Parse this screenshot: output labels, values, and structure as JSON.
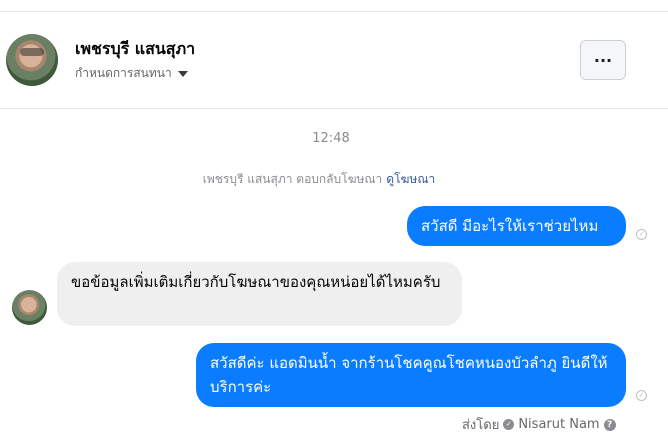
{
  "header": {
    "name": "เพชรบุรี แสนสุภา",
    "subtitle": "กำหนดการสนทนา",
    "more_label": "···"
  },
  "conversation": {
    "timestamp": "12:48",
    "ad_reply_text": "เพชรบุรี แสนสุภา ตอบกลับโฆษณา",
    "ad_link": "ดูโฆษณา",
    "messages": [
      {
        "direction": "outgoing",
        "text": "สวัสดี มีอะไรให้เราช่วยไหม"
      },
      {
        "direction": "incoming",
        "text": "ขอข้อมูลเพิ่มเติมเกี่ยวกับโฆษณาของคุณหน่อยได้ไหมครับ"
      },
      {
        "direction": "outgoing",
        "text": "สวัสดีค่ะ แอดมินน้ำ จากร้านโชคคูณโชคหนองบัวลำภู ยินดีให้บริการค่ะ"
      }
    ],
    "sent_by_label": "ส่งโดย",
    "sent_by_name": "Nisarut Nam"
  },
  "colors": {
    "outgoing_bubble": "#0a7cff",
    "incoming_bubble": "#efefef",
    "link": "#385898"
  },
  "icons": {
    "more": "ellipsis-icon",
    "caret": "caret-down-icon",
    "seen": "seen-check-icon",
    "sender_check": "check-circle-icon",
    "help": "help-icon"
  }
}
